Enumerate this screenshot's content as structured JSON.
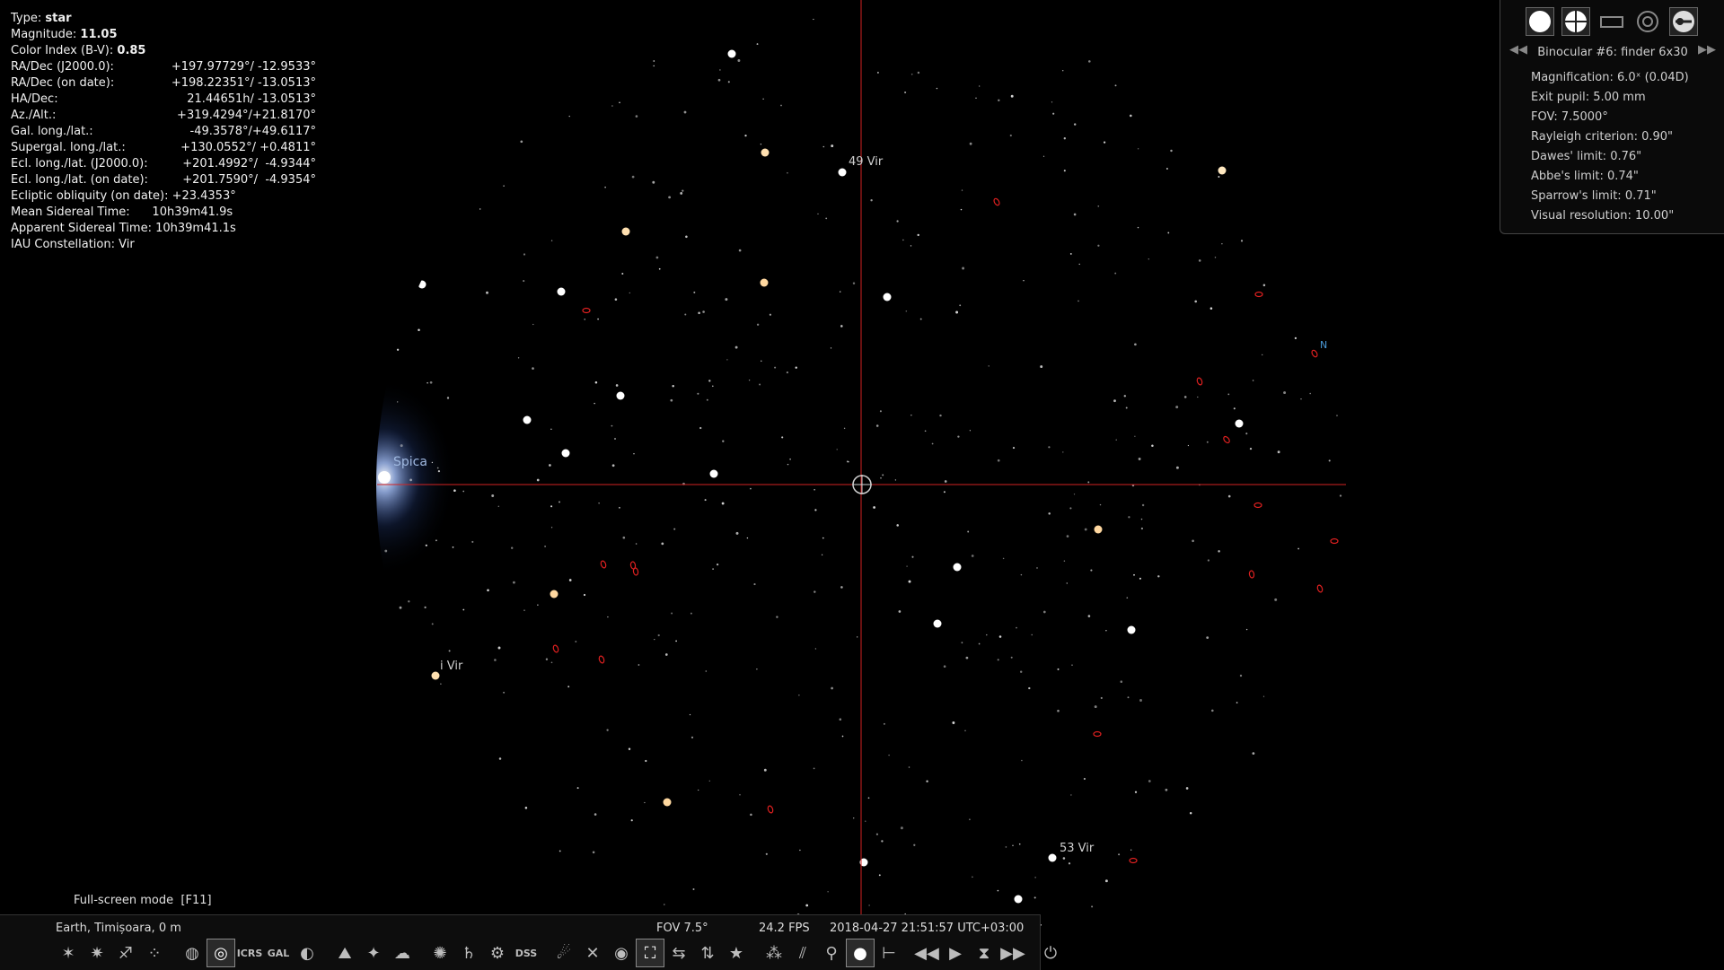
{
  "object_info": {
    "type_label": "Type:",
    "type_value": "star",
    "magnitude_label": "Magnitude:",
    "magnitude_value": "11.05",
    "color_index_label": "Color Index (B-V):",
    "color_index_value": "0.85",
    "rows": [
      {
        "label": "RA/Dec (J2000.0):",
        "value": "+197.97729°/ -12.9533°"
      },
      {
        "label": "RA/Dec (on date):",
        "value": "+198.22351°/ -13.0513°"
      },
      {
        "label": "HA/Dec:",
        "value": "21.44651h/ -13.0513°"
      },
      {
        "label": "Az./Alt.:",
        "value": "+319.4294°/+21.8170°"
      },
      {
        "label": "Gal. long./lat.:",
        "value": "-49.3578°/+49.6117°"
      },
      {
        "label": "Supergal. long./lat.:",
        "value": "+130.0552°/ +0.4811°"
      },
      {
        "label": "Ecl. long./lat. (J2000.0):",
        "value": "+201.4992°/  -4.9344°"
      },
      {
        "label": "Ecl. long./lat. (on date):",
        "value": "+201.7590°/  -4.9354°"
      }
    ],
    "extra_rows": [
      "Ecliptic obliquity (on date): +23.4353°",
      "Mean Sidereal Time:      10h39m41.9s",
      "Apparent Sidereal Time: 10h39m41.1s",
      "IAU Constellation: Vir"
    ]
  },
  "ocular_panel": {
    "title": "Binocular #6: finder 6x30",
    "prev_icon": "prev-arrow-icon",
    "next_icon": "next-arrow-icon",
    "lines": [
      "Magnification: 6.0ˣ (0.04D)",
      "Exit pupil: 5.00 mm",
      "FOV: 7.5000°",
      "Rayleigh criterion: 0.90\"",
      "Dawes' limit: 0.76\"",
      "Abbe's limit: 0.74\"",
      "Sparrow's limit: 0.71\"",
      "Visual resolution: 10.00\""
    ],
    "icons": [
      "ocular-view-icon",
      "crosshair-icon",
      "sensor-frame-icon",
      "telrad-icon",
      "configure-icon"
    ]
  },
  "sky_labels": {
    "spica": "Spica",
    "vir49": "49 Vir",
    "vir53": "53 Vir",
    "i_vir": "i Vir",
    "north": "N"
  },
  "hint": "Full-screen mode  [F11]",
  "status": {
    "location": "Earth, Timișoara, 0 m",
    "fov": "FOV 7.5°",
    "fps": "24.2 FPS",
    "datetime": "2018-04-27 21:51:57 UTC+03:00"
  },
  "toolbar": {
    "ra_dec_label": "ICRS",
    "gal_label": "GAL",
    "dss_label": "DSS"
  },
  "colors": {
    "crosshair": "#d22222",
    "nebula_marker": "#e02020",
    "background": "#000000"
  }
}
